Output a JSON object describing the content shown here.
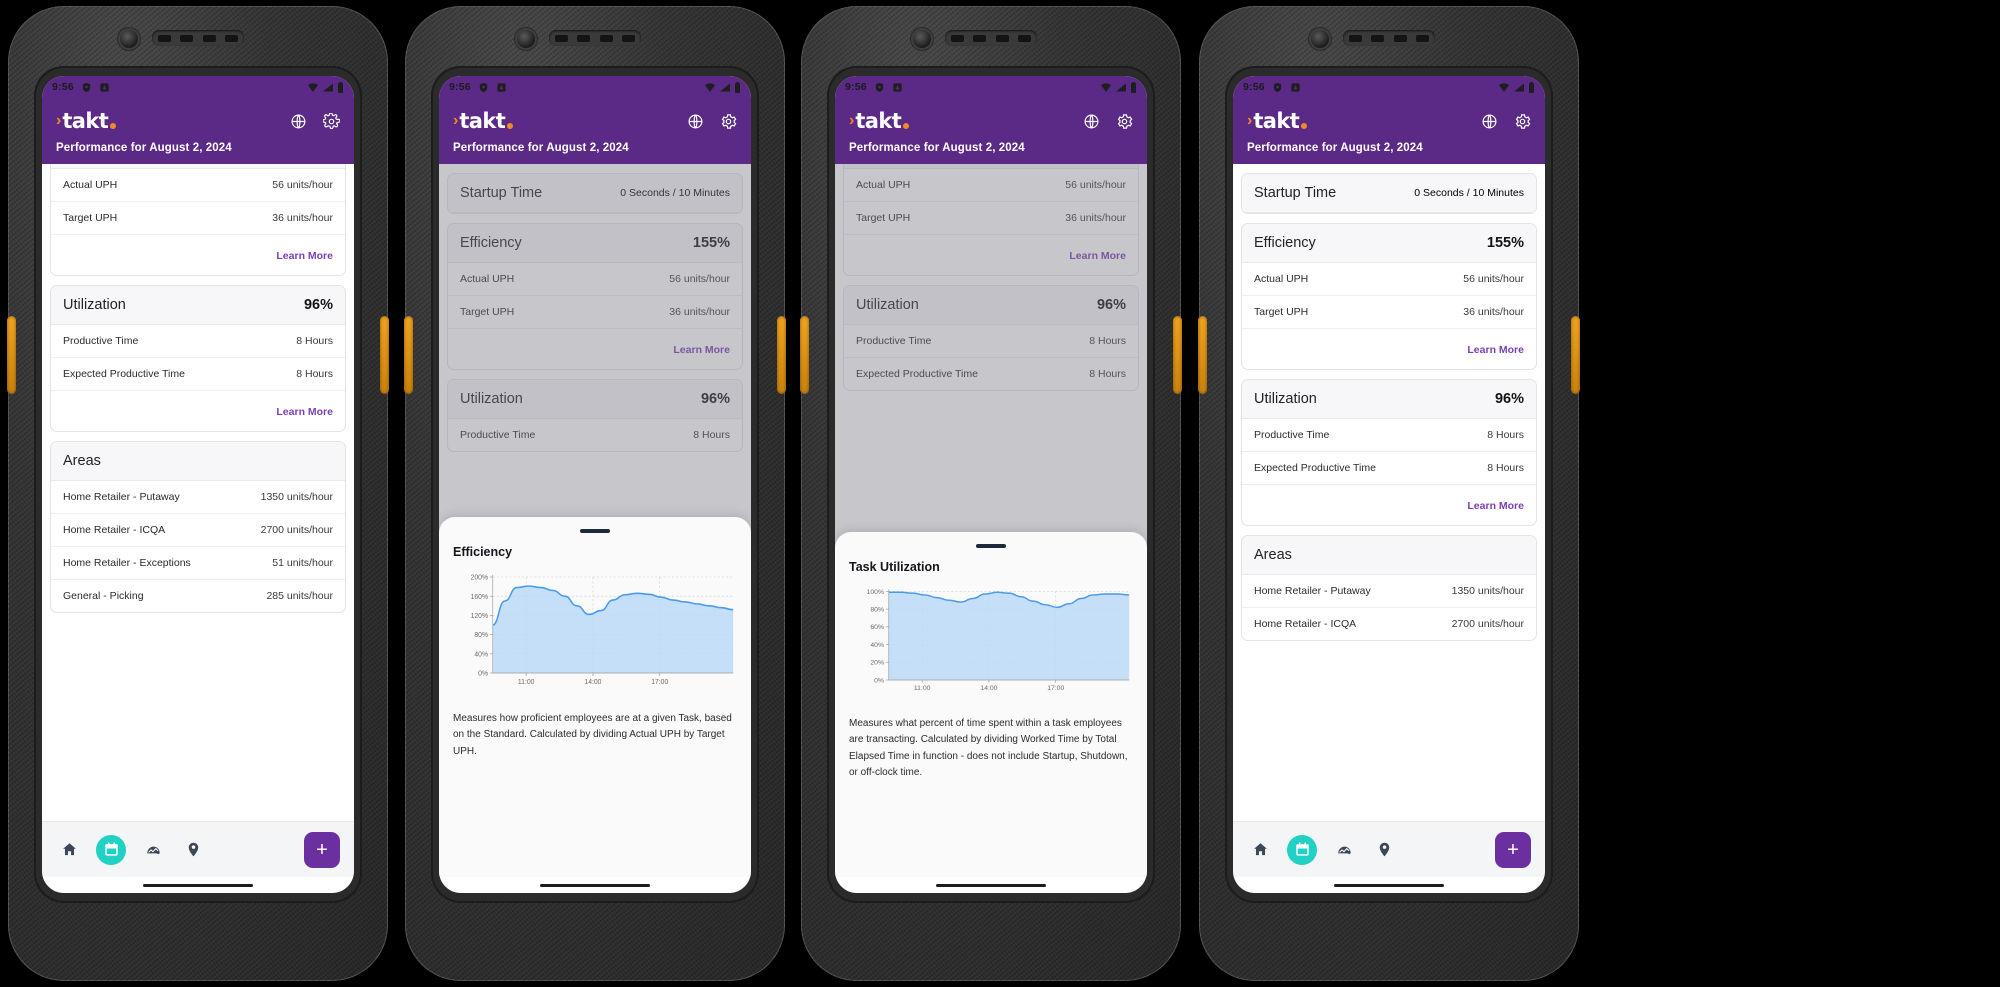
{
  "status_bar": {
    "time": "9:56",
    "icons": [
      "shield-icon",
      "app-badge-icon",
      "wifi-icon",
      "signal-icon",
      "battery-icon"
    ]
  },
  "app_bar": {
    "logo_text": "takt",
    "title": "Performance for August 2, 2024",
    "globe_icon": "globe-icon",
    "settings_icon": "gear-icon"
  },
  "cards": {
    "startup": {
      "title": "Startup Time",
      "value": "0 Seconds / 10 Minutes"
    },
    "efficiency": {
      "title": "Efficiency",
      "value": "155%",
      "rows": [
        {
          "label": "Actual UPH",
          "value": "56 units/hour"
        },
        {
          "label": "Target UPH",
          "value": "36 units/hour"
        }
      ],
      "learn_more": "Learn More"
    },
    "utilization": {
      "title": "Utilization",
      "value": "96%",
      "rows": [
        {
          "label": "Productive Time",
          "value": "8 Hours"
        },
        {
          "label": "Expected Productive Time",
          "value": "8 Hours"
        }
      ],
      "learn_more": "Learn More"
    },
    "areas": {
      "title": "Areas",
      "rows": [
        {
          "label": "Home Retailer - Putaway",
          "value": "1350 units/hour"
        },
        {
          "label": "Home Retailer - ICQA",
          "value": "2700 units/hour"
        },
        {
          "label": "Home Retailer - Exceptions",
          "value": "51 units/hour"
        },
        {
          "label": "General - Picking",
          "value": "285 units/hour"
        }
      ]
    }
  },
  "bottom_nav": {
    "items": [
      "home-icon",
      "calendar-icon",
      "chart-icon",
      "location-pin-icon"
    ],
    "active_index": 1,
    "fab_label": "+"
  },
  "sheets": {
    "efficiency": {
      "title": "Efficiency",
      "description": "Measures how proficient employees are at a given Task, based on the Standard. Calculated by dividing Actual UPH by Target UPH."
    },
    "task_utilization": {
      "title": "Task Utilization",
      "description": "Measures what percent of time spent within a task employees are transacting. Calculated by dividing Worked Time by Total Elapsed Time in function - does not include Startup, Shutdown, or off-clock time."
    }
  },
  "colors": {
    "brand_purple": "#5b2a86",
    "fab_purple": "#6c2fa0",
    "accent_orange": "#f08a24",
    "nav_active_teal": "#21d2c4",
    "link_purple": "#7b3fb5",
    "chart_line": "#4a9bea",
    "chart_fill": "#bcd9f7"
  },
  "chart_data": [
    {
      "id": "efficiency-chart",
      "type": "area",
      "title": "Efficiency",
      "xlabel": "",
      "ylabel": "",
      "ylim": [
        0,
        200
      ],
      "yticks": [
        "0%",
        "40%",
        "80%",
        "120%",
        "160%",
        "200%"
      ],
      "ytick_values": [
        0,
        40,
        80,
        120,
        160,
        200
      ],
      "xticks": [
        "11:00",
        "14:00",
        "17:00"
      ],
      "grid": true,
      "x": [
        0,
        1,
        2,
        3,
        4,
        5,
        6,
        7,
        8,
        9,
        10,
        11,
        12,
        13,
        14,
        15,
        16,
        17,
        18,
        19,
        20
      ],
      "values": [
        100,
        150,
        178,
        181,
        178,
        172,
        160,
        140,
        122,
        130,
        152,
        163,
        166,
        164,
        158,
        152,
        148,
        144,
        140,
        136,
        132
      ]
    },
    {
      "id": "task-utilization-chart",
      "type": "area",
      "title": "Task Utilization",
      "xlabel": "",
      "ylabel": "",
      "ylim": [
        0,
        100
      ],
      "yticks": [
        "0%",
        "20%",
        "40%",
        "60%",
        "80%",
        "100%"
      ],
      "ytick_values": [
        0,
        20,
        40,
        60,
        80,
        100
      ],
      "xticks": [
        "11:00",
        "14:00",
        "17:00"
      ],
      "grid": true,
      "x": [
        0,
        1,
        2,
        3,
        4,
        5,
        6,
        7,
        8,
        9,
        10,
        11,
        12,
        13,
        14,
        15,
        16,
        17,
        18,
        19,
        20
      ],
      "values": [
        99,
        99,
        98,
        96,
        93,
        90,
        88,
        92,
        97,
        99,
        98,
        94,
        89,
        85,
        82,
        86,
        92,
        96,
        97,
        97,
        96
      ]
    }
  ]
}
